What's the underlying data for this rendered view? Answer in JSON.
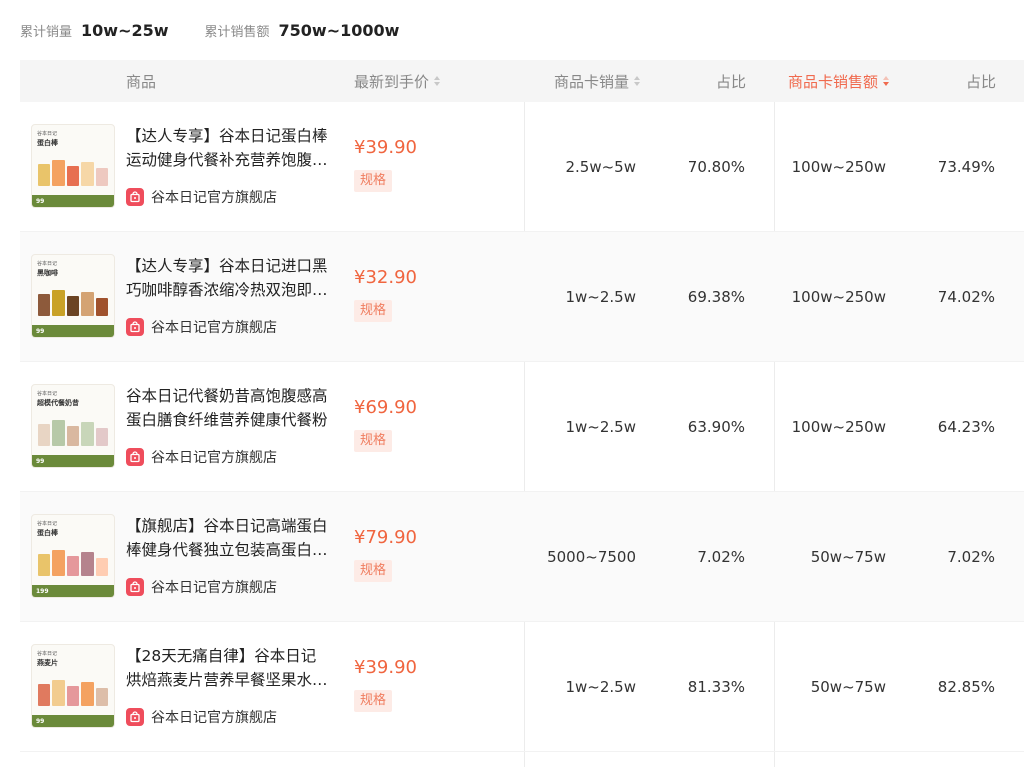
{
  "stats": {
    "sales_label": "累计销量",
    "sales_value": "10w~25w",
    "revenue_label": "累计销售额",
    "revenue_value": "750w~1000w"
  },
  "columns": {
    "product": "商品",
    "price": "最新到手价",
    "card_sales": "商品卡销量",
    "card_sales_share": "占比",
    "card_revenue": "商品卡销售额",
    "card_revenue_share": "占比"
  },
  "rows": [
    {
      "title": "【达人专享】谷本日记蛋白棒运动健身代餐补充营养饱腹能量棒",
      "shop": "谷本日记官方旗舰店",
      "price": "¥39.90",
      "spec": "规格",
      "card_sales": "2.5w~5w",
      "card_sales_share": "70.80%",
      "card_revenue": "100w~250w",
      "card_revenue_share": "73.49%",
      "thumb": {
        "brand": "谷本日记",
        "name": "蛋白棒",
        "price": "99",
        "colors": [
          "#e9c46a",
          "#f4a261",
          "#e76f51",
          "#f6d7a7",
          "#eec9c0"
        ]
      }
    },
    {
      "title": "【达人专享】谷本日记进口黑巧咖啡醇香浓缩冷热双泡即溶咖啡",
      "shop": "谷本日记官方旗舰店",
      "price": "¥32.90",
      "spec": "规格",
      "card_sales": "1w~2.5w",
      "card_sales_share": "69.38%",
      "card_revenue": "100w~250w",
      "card_revenue_share": "74.02%",
      "thumb": {
        "brand": "谷本日记",
        "name": "黑咖啡",
        "price": "99",
        "colors": [
          "#8d5a3b",
          "#c9a227",
          "#6b4423",
          "#d4a373",
          "#a0522d"
        ]
      }
    },
    {
      "title": "谷本日记代餐奶昔高饱腹感高蛋白膳食纤维营养健康代餐粉",
      "shop": "谷本日记官方旗舰店",
      "price": "¥69.90",
      "spec": "规格",
      "card_sales": "1w~2.5w",
      "card_sales_share": "63.90%",
      "card_revenue": "100w~250w",
      "card_revenue_share": "64.23%",
      "thumb": {
        "brand": "谷本日记",
        "name": "超模代餐奶昔",
        "price": "99",
        "colors": [
          "#e8d5c4",
          "#b7c9a8",
          "#d9b8a0",
          "#c8d6b9",
          "#e3c9c9"
        ]
      }
    },
    {
      "title": "【旗舰店】谷本日记高端蛋白棒健身代餐独立包装高蛋白零食",
      "shop": "谷本日记官方旗舰店",
      "price": "¥79.90",
      "spec": "规格",
      "card_sales": "5000~7500",
      "card_sales_share": "7.02%",
      "card_revenue": "50w~75w",
      "card_revenue_share": "7.02%",
      "thumb": {
        "brand": "谷本日记",
        "name": "蛋白棒",
        "price": "199",
        "colors": [
          "#e9c46a",
          "#f4a261",
          "#e5989b",
          "#b5838d",
          "#ffcdb2"
        ]
      }
    },
    {
      "title": "【28天无痛自律】谷本日记烘焙燕麦片营养早餐坚果水果麦片",
      "shop": "谷本日记官方旗舰店",
      "price": "¥39.90",
      "spec": "规格",
      "card_sales": "1w~2.5w",
      "card_sales_share": "81.33%",
      "card_revenue": "50w~75w",
      "card_revenue_share": "82.85%",
      "thumb": {
        "brand": "谷本日记",
        "name": "燕麦片",
        "price": "99",
        "colors": [
          "#e07a5f",
          "#f2cc8f",
          "#e5989b",
          "#f4a261",
          "#ddbea9"
        ]
      }
    }
  ]
}
